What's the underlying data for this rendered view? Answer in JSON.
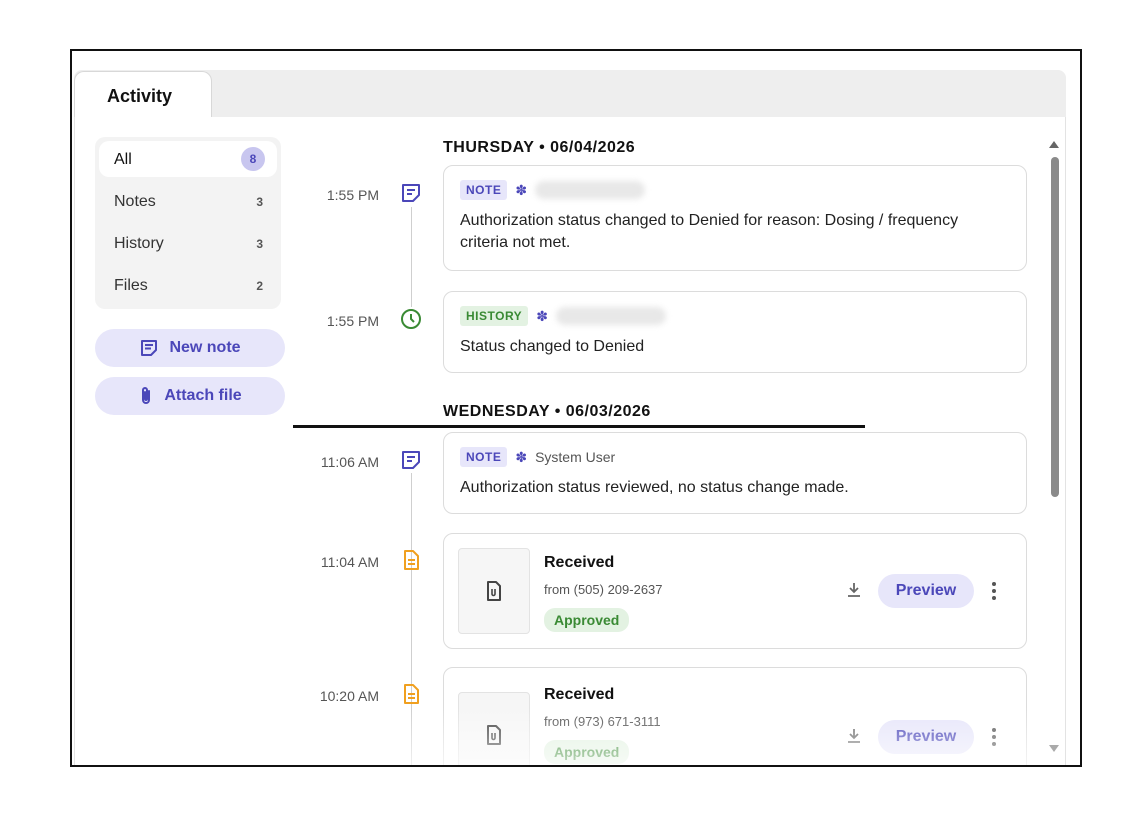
{
  "tabs": {
    "activity": "Activity"
  },
  "filters": [
    {
      "label": "All",
      "count": "8"
    },
    {
      "label": "Notes",
      "count": "3"
    },
    {
      "label": "History",
      "count": "3"
    },
    {
      "label": "Files",
      "count": "2"
    }
  ],
  "actions": {
    "new_note": "New note",
    "attach_file": "Attach file"
  },
  "days": [
    {
      "header": "THURSDAY • 06/04/2026"
    },
    {
      "header": "WEDNESDAY • 06/03/2026"
    }
  ],
  "entries": [
    {
      "time": "1:55 PM",
      "tag": "NOTE",
      "text": "Authorization status changed to Denied for reason: Dosing / frequency criteria not met."
    },
    {
      "time": "1:55 PM",
      "tag": "HISTORY",
      "text": "Status changed to Denied"
    },
    {
      "time": "11:06 AM",
      "tag": "NOTE",
      "author": "System User",
      "text": "Authorization status reviewed, no status change made."
    },
    {
      "time": "11:04 AM",
      "title": "Received",
      "from": "from (505) 209-2637",
      "status": "Approved",
      "preview": "Preview"
    },
    {
      "time": "10:20 AM",
      "title": "Received",
      "from": "from (973) 671-3111",
      "status": "Approved",
      "preview": "Preview"
    }
  ],
  "colors": {
    "accent": "#4b47b9",
    "accent_bg": "#e7e6fa",
    "history": "#3a8a34",
    "file": "#f0a020"
  }
}
